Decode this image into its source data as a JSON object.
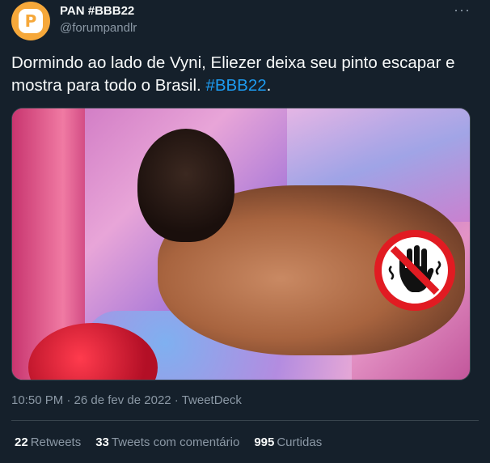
{
  "header": {
    "name": "PAN #BBB22",
    "handle": "@forumpandlr",
    "more": "···"
  },
  "tweet": {
    "text": "Dormindo ao lado de Vyni, Eliezer deixa seu pinto escapar e mostra para todo o Brasil.",
    "hashtag": "#BBB22",
    "trailing": "."
  },
  "meta": {
    "time": "10:50 PM · 26 de fev de 2022 · TweetDeck"
  },
  "stats": {
    "retweets_count": "22",
    "retweets_label": "Retweets",
    "quotes_count": "33",
    "quotes_label": "Tweets com comentário",
    "likes_count": "995",
    "likes_label": "Curtidas"
  },
  "colors": {
    "background": "#15202b",
    "hashtag": "#1d9bf0",
    "muted": "#8b98a5",
    "avatar": "#f6a83a"
  },
  "icons": {
    "avatar": "pan-logo-icon",
    "no_touch": "no-touch-hand-icon"
  }
}
